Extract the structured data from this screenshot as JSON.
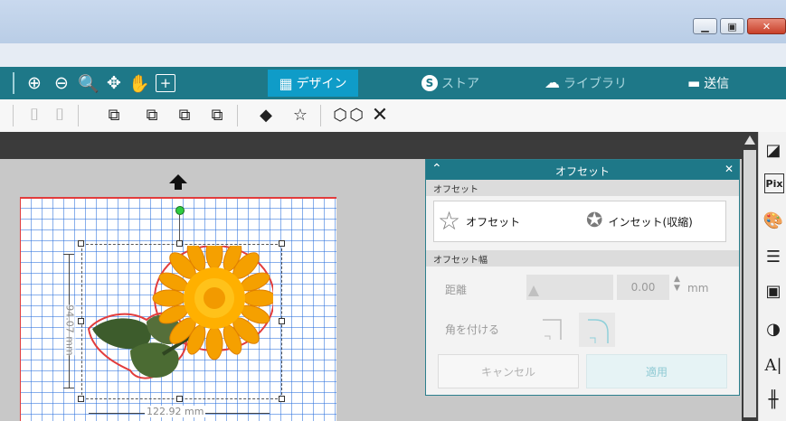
{
  "window": {
    "minimize_icon": "minimize-icon",
    "maximize_icon": "maximize-icon",
    "close_icon": "close-icon"
  },
  "nav": {
    "tabs": [
      {
        "label": "デザイン",
        "icon": "grid-icon",
        "active": true
      },
      {
        "label": "ストア",
        "icon": "store-icon",
        "active": false
      },
      {
        "label": "ライブラリ",
        "icon": "cloud-icon",
        "active": false
      },
      {
        "label": "送信",
        "icon": "send-icon",
        "active": false
      }
    ]
  },
  "canvas": {
    "height_dimension": "94.07 mm",
    "width_dimension": "122.92 mm"
  },
  "offset_panel": {
    "title": "オフセット",
    "section_offset": "オフセット",
    "offset_button": "オフセット",
    "inset_button": "インセット(収縮)",
    "section_width": "オフセット幅",
    "distance_label": "距離",
    "distance_value": "0.00",
    "distance_unit": "mm",
    "corner_label": "角を付ける",
    "cancel_button": "キャンセル",
    "apply_button": "適用"
  },
  "right_panel": {
    "pix_label": "Pix",
    "text_label": "A|"
  },
  "colors": {
    "nav_bg": "#1e7888",
    "active_tab": "#0f9cc8",
    "panel_head": "#1e7888",
    "mat_grid": "#2e6ee0",
    "cut_line": "#e23c3c"
  }
}
